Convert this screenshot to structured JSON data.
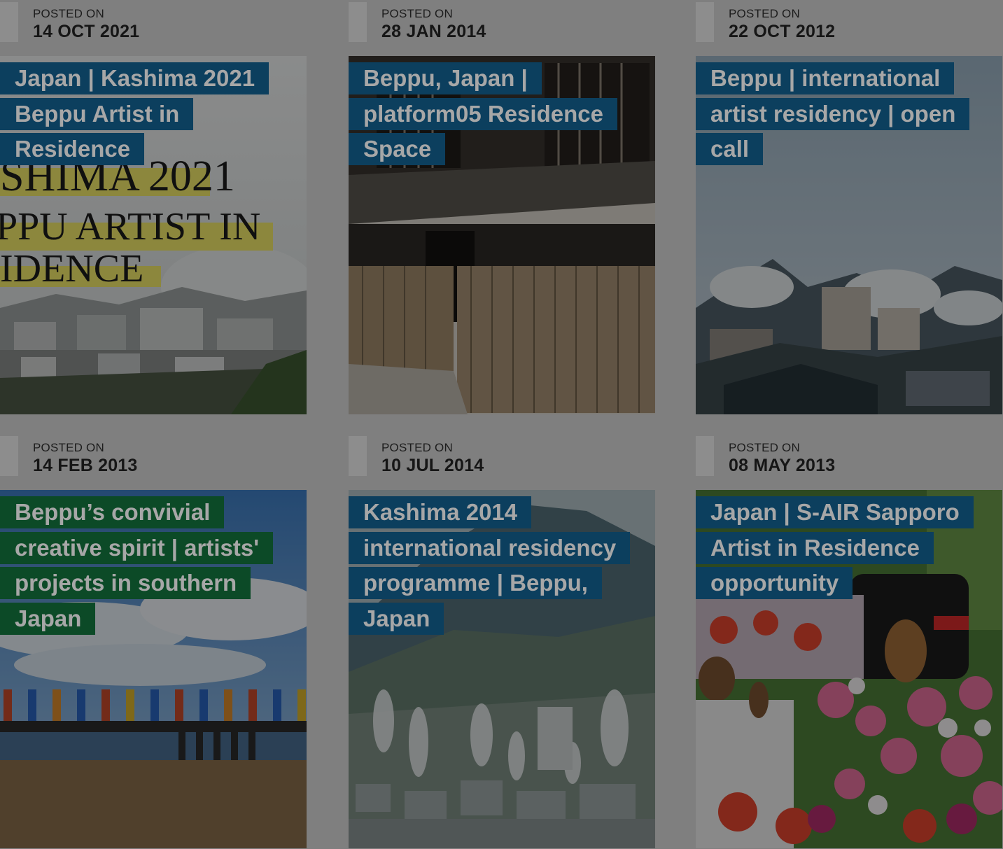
{
  "posted_label": "POSTED ON",
  "posts": [
    {
      "date": "14 OCT 2021",
      "title": "Japan | Kashima 2021 Beppu Artist in Residence",
      "title_color": "#0c3f5e",
      "image": "kashima-2021-poster-photo"
    },
    {
      "date": "28 JAN 2014",
      "title": "Beppu, Japan | platform05 Residence Space",
      "title_color": "#0c3f5e",
      "image": "wooden-townhouse-photo"
    },
    {
      "date": "22 OCT 2012",
      "title": "Beppu | international artist residency | open call",
      "title_color": "#0c3f5e",
      "image": "steaming-town-photo"
    },
    {
      "date": "14 FEB 2013",
      "title": "Beppu’s convivial creative spirit | artists' projects in southern Japan",
      "title_color": "#0c4a27",
      "image": "pier-flags-photo"
    },
    {
      "date": "10 JUL 2014",
      "title": "Kashima 2014 international residency programme | Beppu, Japan",
      "title_color": "#0c3f5e",
      "image": "beppu-valley-steam-photo"
    },
    {
      "date": "08 MAY 2013",
      "title": "Japan | S-AIR Sapporo Artist in Residence opportunity",
      "title_color": "#0c3f5e",
      "image": "flowers-person-photo"
    }
  ],
  "poster_text": [
    "SHIMA 2021",
    "PPU ARTIST IN",
    "IDENCE"
  ]
}
